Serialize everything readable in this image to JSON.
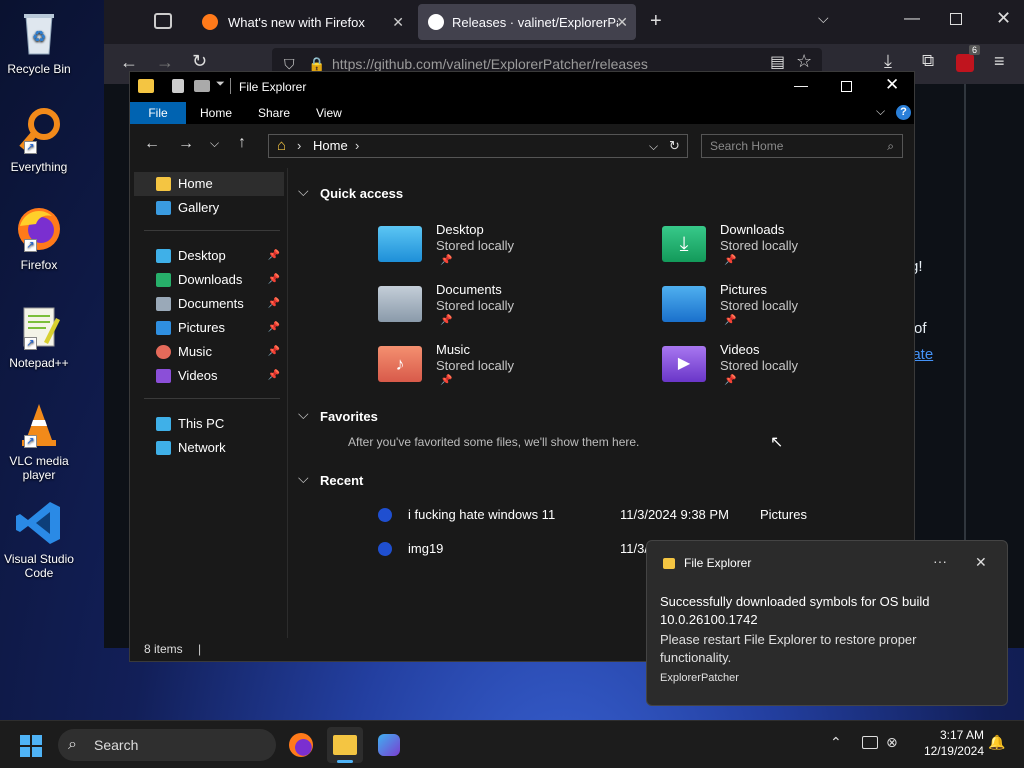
{
  "desktop": {
    "icons": [
      {
        "label": "Recycle Bin"
      },
      {
        "label": "Everything"
      },
      {
        "label": "Firefox"
      },
      {
        "label": "Notepad++"
      },
      {
        "label": "VLC media player"
      },
      {
        "label": "Visual Studio Code"
      }
    ]
  },
  "firefox": {
    "tabs": [
      {
        "label": "What's new with Firefox"
      },
      {
        "label": "Releases · valinet/ExplorerPatche"
      }
    ],
    "url": "https://github.com/valinet/ExplorerPatcher/releases",
    "badge_count": "6",
    "page_fragments": [
      "g!",
      "of",
      "pate"
    ]
  },
  "explorer": {
    "title": "File Explorer",
    "ribbon_tabs": [
      "File",
      "Home",
      "Share",
      "View"
    ],
    "breadcrumb": "Home",
    "search_placeholder": "Search Home",
    "sidebar": {
      "top": [
        {
          "label": "Home"
        },
        {
          "label": "Gallery"
        }
      ],
      "pinned": [
        {
          "label": "Desktop"
        },
        {
          "label": "Downloads"
        },
        {
          "label": "Documents"
        },
        {
          "label": "Pictures"
        },
        {
          "label": "Music"
        },
        {
          "label": "Videos"
        }
      ],
      "bottom": [
        {
          "label": "This PC"
        },
        {
          "label": "Network"
        }
      ]
    },
    "quick_access": {
      "title": "Quick access",
      "items": [
        {
          "name": "Desktop",
          "sub": "Stored locally"
        },
        {
          "name": "Downloads",
          "sub": "Stored locally"
        },
        {
          "name": "Documents",
          "sub": "Stored locally"
        },
        {
          "name": "Pictures",
          "sub": "Stored locally"
        },
        {
          "name": "Music",
          "sub": "Stored locally"
        },
        {
          "name": "Videos",
          "sub": "Stored locally"
        }
      ]
    },
    "favorites": {
      "title": "Favorites",
      "empty_text": "After you've favorited some files, we'll show them here."
    },
    "recent": {
      "title": "Recent",
      "rows": [
        {
          "name": "i fucking hate windows 11",
          "date": "11/3/2024 9:38 PM",
          "location": "Pictures"
        },
        {
          "name": "img19",
          "date": "11/3/",
          "location": ""
        }
      ]
    },
    "status": "8 items"
  },
  "toast": {
    "app": "File Explorer",
    "heading": "Successfully downloaded symbols for OS build 10.0.26100.1742",
    "body": "Please restart File Explorer to restore proper functionality.",
    "source": "ExplorerPatcher"
  },
  "taskbar": {
    "search_label": "Search",
    "time": "3:17 AM",
    "date": "12/19/2024"
  }
}
